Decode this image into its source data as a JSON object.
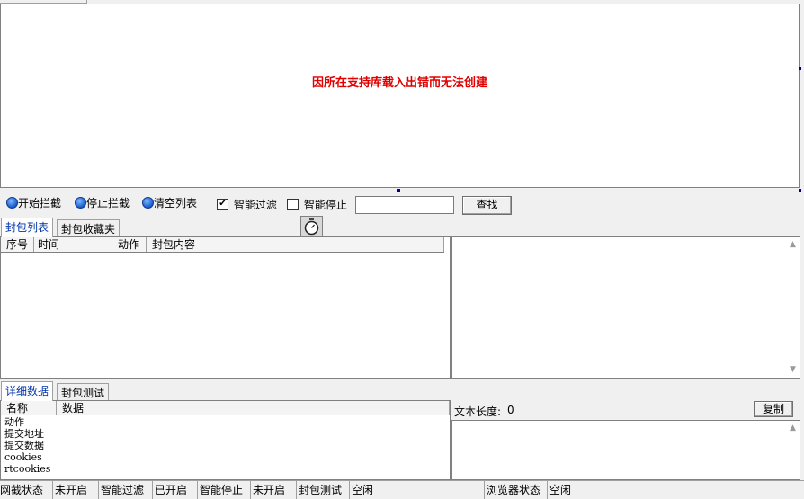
{
  "browser_area": {
    "error_message": "因所在支持库载入出错而无法创建"
  },
  "toolbar": {
    "start_label": "开始拦截",
    "stop_label": "停止拦截",
    "clear_label": "清空列表",
    "smart_filter_label": "智能过滤",
    "smart_filter_checked": true,
    "smart_stop_label": "智能停止",
    "smart_stop_checked": false,
    "search_value": "",
    "search_button": "查找"
  },
  "packet_tabs": [
    {
      "label": "封包列表",
      "active": true
    },
    {
      "label": "封包收藏夹",
      "active": false
    }
  ],
  "packet_table": {
    "columns": [
      "序号",
      "时间",
      "动作",
      "封包内容"
    ],
    "rows": []
  },
  "detail_tabs": [
    {
      "label": "详细数据",
      "active": true
    },
    {
      "label": "封包测试",
      "active": false
    }
  ],
  "detail_table": {
    "columns": [
      "名称",
      "数据"
    ],
    "rows": [
      "动作",
      "提交地址",
      "提交数据",
      "cookies",
      "rtcookies"
    ]
  },
  "text_panel": {
    "length_label": "文本长度:",
    "length_value": "0",
    "copy_button": "复制"
  },
  "status_bar": {
    "items": [
      "网截状态",
      "未开启",
      "智能过滤",
      "已开启",
      "智能停止",
      "未开启",
      "封包测试",
      "空闲",
      "浏览器状态",
      "空闲"
    ]
  },
  "colors": {
    "error_text": "#e00000",
    "tab_active_text": "#0033aa",
    "icon_blue": "#1a58c8"
  }
}
